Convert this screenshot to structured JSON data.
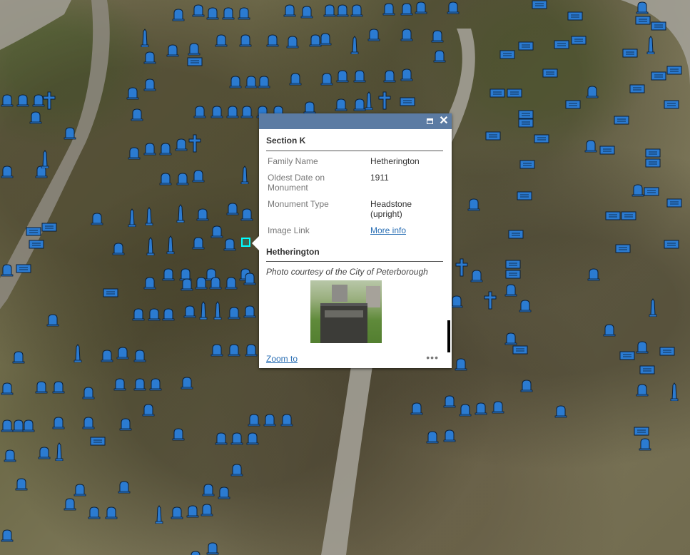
{
  "popup": {
    "section_title": "Section K",
    "fields": [
      {
        "name": "Family Name",
        "value": "Hetherington",
        "is_link": false
      },
      {
        "name": "Oldest Date on Monument",
        "value": "1911",
        "is_link": false
      },
      {
        "name": "Monument Type",
        "value": "Headstone (upright)",
        "is_link": false
      },
      {
        "name": "Image Link",
        "value": "More info",
        "is_link": true
      }
    ],
    "media_title": "Hetherington",
    "media_caption": "Photo courtesy of the City of Peterborough",
    "zoom_label": "Zoom to",
    "more_label": "•••",
    "close_label": "✕"
  },
  "map": {
    "marker_colors": {
      "fill": "#2b7bd1",
      "outline": "#0c1f36",
      "selection": "#00ffff"
    },
    "icons": [
      "headstone-marker-icon",
      "obelisk-marker-icon",
      "cross-marker-icon",
      "flat-marker-icon"
    ]
  }
}
